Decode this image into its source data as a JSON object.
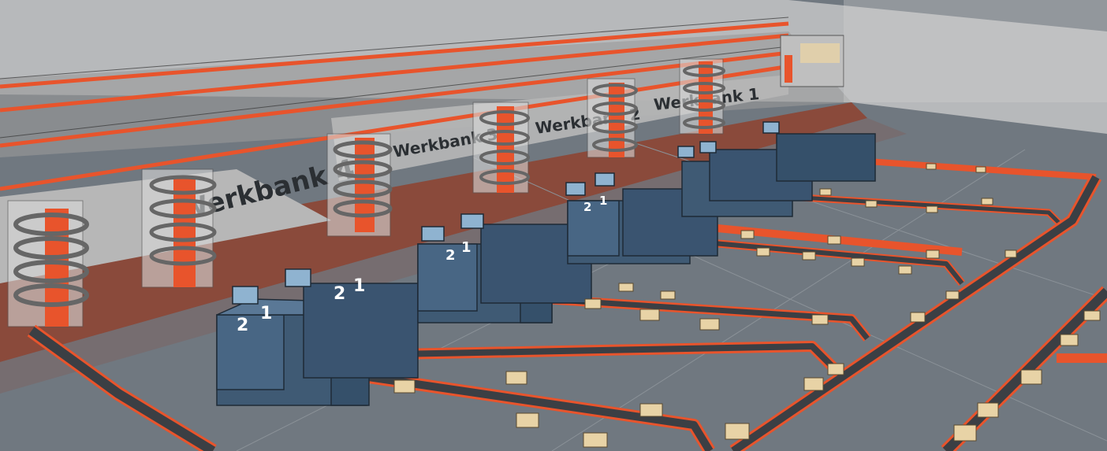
{
  "scene": {
    "floor_markings": [
      {
        "text": "Werkbank 4"
      },
      {
        "text": "Werkbank 3"
      },
      {
        "text": "Werkbank 2"
      },
      {
        "text": "Werkbank 1"
      }
    ],
    "station_labels": [
      "2",
      "1",
      "2",
      "1",
      "2",
      "1",
      "2",
      "1"
    ],
    "colors": {
      "floor": "#6f7780",
      "floor_band": "#8a4a3b",
      "conveyor_rail": "#e8542c",
      "conveyor_belt": "#3b3f44",
      "machine": "#3f5a74",
      "box": "#e8d3a6",
      "wall": "#c8c8c8",
      "spiral": "#d9d9d9"
    }
  }
}
